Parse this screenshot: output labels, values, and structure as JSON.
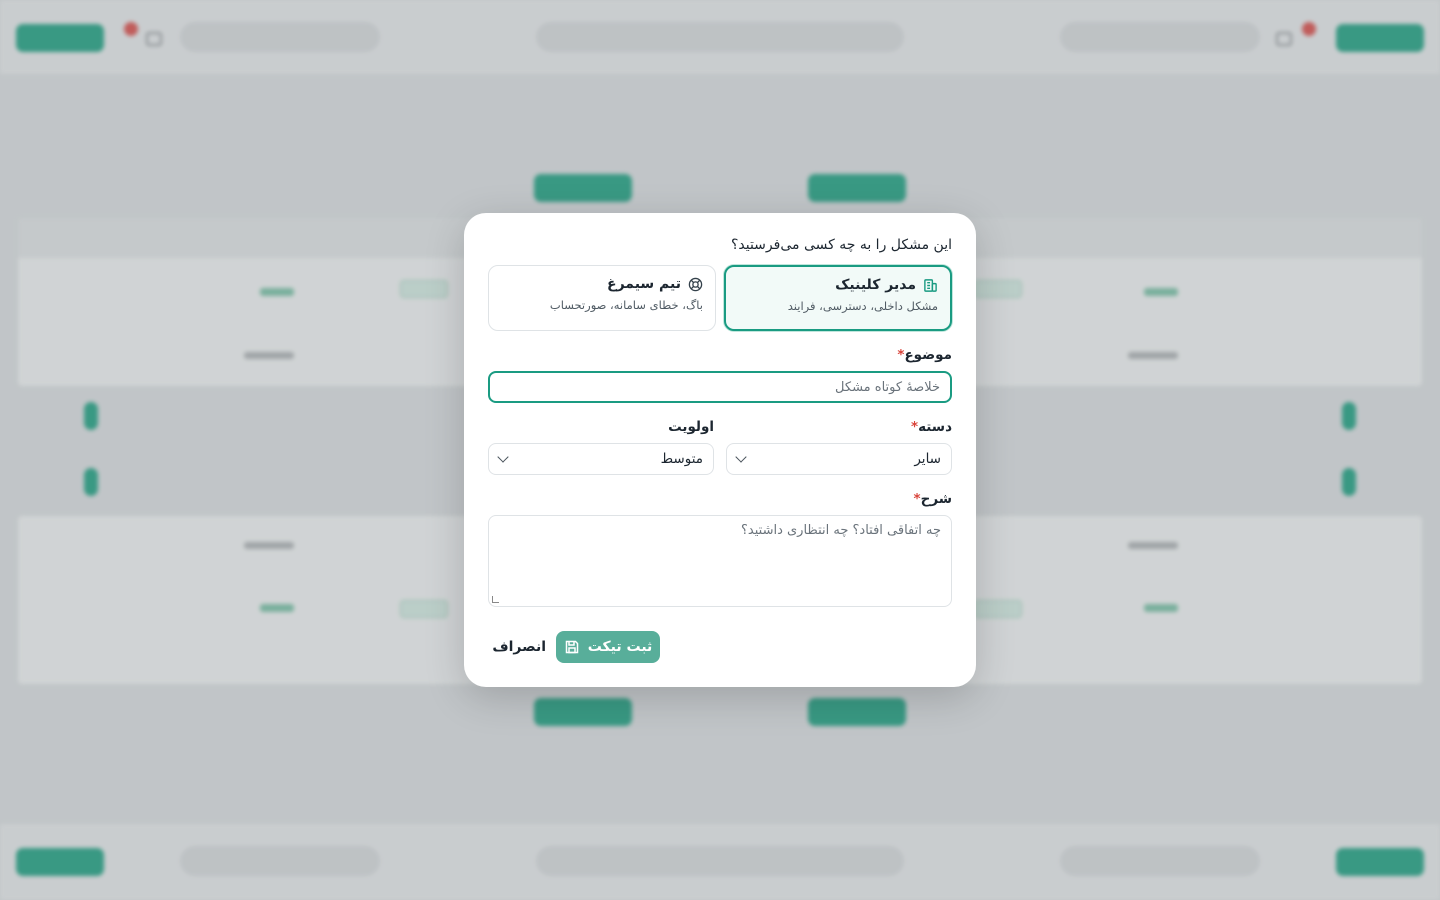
{
  "dialog": {
    "question": "این مشکل را به چه کسی می‌فرستید؟",
    "recipients": [
      {
        "title": "مدیر کلینیک",
        "subtitle": "مشکل داخلی، دسترسی، فرایند",
        "icon": "building-icon",
        "selected": true
      },
      {
        "title": "تیم سیمرغ",
        "subtitle": "باگ، خطای سامانه، صورتحساب",
        "icon": "lifebuoy-icon",
        "selected": false
      }
    ],
    "subject": {
      "label": "موضوع",
      "required_mark": "*",
      "placeholder": "خلاصهٔ کوتاه مشکل"
    },
    "category": {
      "label": "دسته",
      "required_mark": "*",
      "value": "سایر"
    },
    "priority": {
      "label": "اولویت",
      "value": "متوسط"
    },
    "description": {
      "label": "شرح",
      "required_mark": "*",
      "placeholder": "چه اتفاقی افتاد؟ چه انتظاری داشتید؟"
    },
    "submit_label": "ثبت تیکت",
    "cancel_label": "انصراف"
  },
  "colors": {
    "accent": "#1a9b82",
    "submit_bg": "#58ae9a",
    "required": "#d9433a"
  }
}
